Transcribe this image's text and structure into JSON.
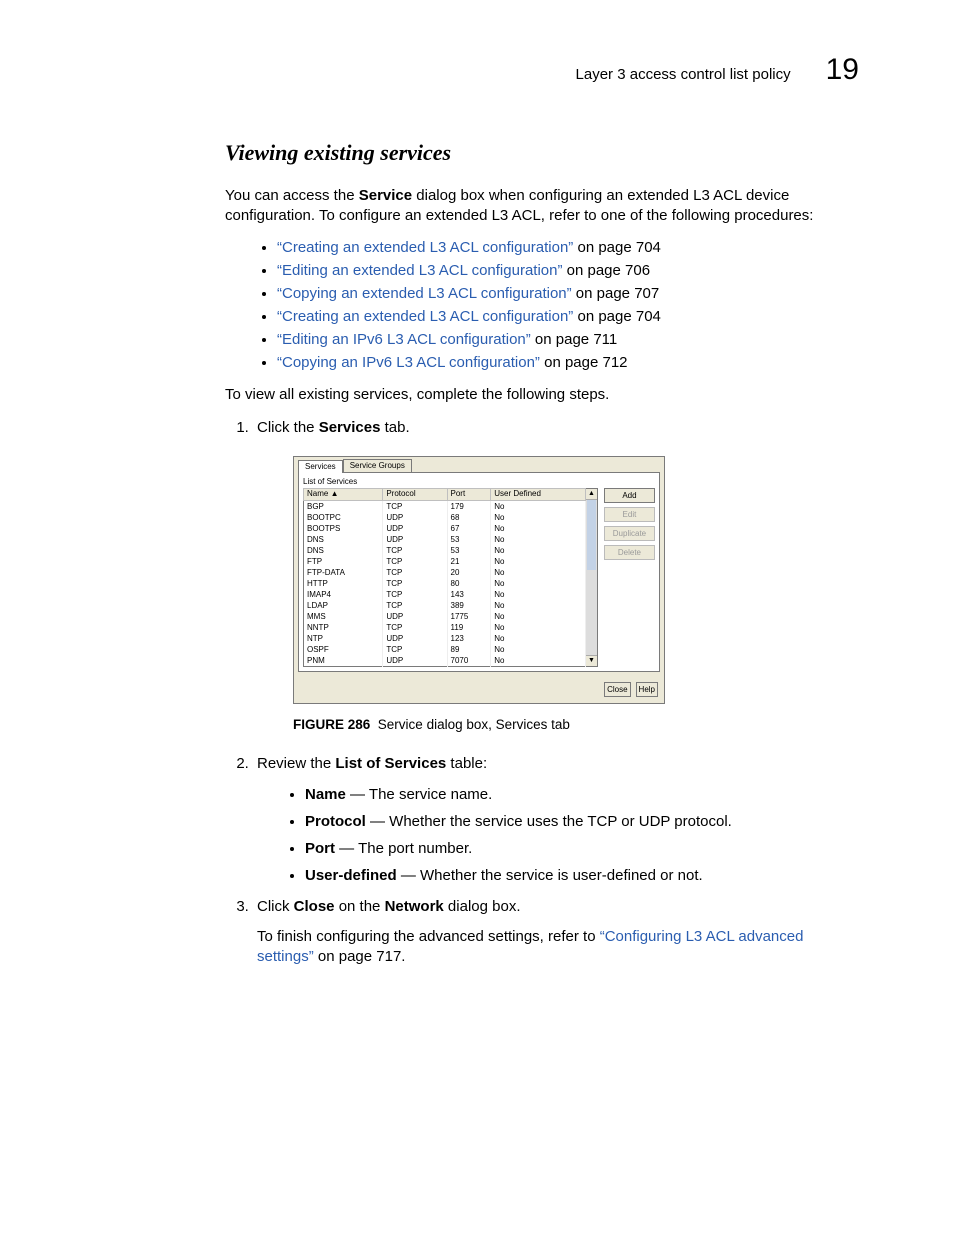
{
  "header": {
    "title": "Layer 3 access control list policy",
    "chapter": "19"
  },
  "section_title": "Viewing existing services",
  "intro": {
    "p1a": "You can access the ",
    "p1b": "Service",
    "p1c": " dialog box when configuring an extended L3 ACL device configuration. To configure an extended L3 ACL, refer to one of the following procedures:"
  },
  "links": [
    {
      "text": "“Creating an extended L3 ACL configuration”",
      "suffix": " on page 704"
    },
    {
      "text": "“Editing an extended L3 ACL configuration”",
      "suffix": " on page 706"
    },
    {
      "text": "“Copying an extended L3 ACL configuration”",
      "suffix": " on page 707"
    },
    {
      "text": "“Creating an extended L3 ACL configuration”",
      "suffix": " on page 704"
    },
    {
      "text": "“Editing an IPv6 L3 ACL configuration”",
      "suffix": " on page 711"
    },
    {
      "text": "“Copying an IPv6 L3 ACL configuration”",
      "suffix": " on page 712"
    }
  ],
  "lead_in": "To view all existing services, complete the following steps.",
  "step1": {
    "pre": "Click the ",
    "bold": "Services",
    "post": " tab."
  },
  "dialog": {
    "tabs": {
      "services": "Services",
      "groups": "Service Groups"
    },
    "list_label": "List of Services",
    "headers": {
      "name": "Name ▲",
      "protocol": "Protocol",
      "port": "Port",
      "userdef": "User Defined"
    },
    "rows": [
      {
        "name": "BGP",
        "protocol": "TCP",
        "port": "179",
        "userdef": "No"
      },
      {
        "name": "BOOTPC",
        "protocol": "UDP",
        "port": "68",
        "userdef": "No"
      },
      {
        "name": "BOOTPS",
        "protocol": "UDP",
        "port": "67",
        "userdef": "No"
      },
      {
        "name": "DNS",
        "protocol": "UDP",
        "port": "53",
        "userdef": "No"
      },
      {
        "name": "DNS",
        "protocol": "TCP",
        "port": "53",
        "userdef": "No"
      },
      {
        "name": "FTP",
        "protocol": "TCP",
        "port": "21",
        "userdef": "No"
      },
      {
        "name": "FTP-DATA",
        "protocol": "TCP",
        "port": "20",
        "userdef": "No"
      },
      {
        "name": "HTTP",
        "protocol": "TCP",
        "port": "80",
        "userdef": "No"
      },
      {
        "name": "IMAP4",
        "protocol": "TCP",
        "port": "143",
        "userdef": "No"
      },
      {
        "name": "LDAP",
        "protocol": "TCP",
        "port": "389",
        "userdef": "No"
      },
      {
        "name": "MMS",
        "protocol": "UDP",
        "port": "1775",
        "userdef": "No"
      },
      {
        "name": "NNTP",
        "protocol": "TCP",
        "port": "119",
        "userdef": "No"
      },
      {
        "name": "NTP",
        "protocol": "UDP",
        "port": "123",
        "userdef": "No"
      },
      {
        "name": "OSPF",
        "protocol": "TCP",
        "port": "89",
        "userdef": "No"
      },
      {
        "name": "PNM",
        "protocol": "UDP",
        "port": "7070",
        "userdef": "No"
      }
    ],
    "buttons": {
      "add": "Add",
      "edit": "Edit",
      "duplicate": "Duplicate",
      "delete": "Delete",
      "close": "Close",
      "help": "Help"
    }
  },
  "figure": {
    "num": "FIGURE 286",
    "caption": "Service dialog box, Services tab"
  },
  "step2": {
    "pre": "Review the ",
    "bold": "List of Services",
    "post": " table:",
    "items": [
      {
        "b": "Name",
        "t": " — The service name."
      },
      {
        "b": "Protocol",
        "t": " — Whether the service uses the TCP or UDP protocol."
      },
      {
        "b": "Port",
        "t": " — The port number."
      },
      {
        "b": "User-defined",
        "t": " — Whether the service is user-defined or not."
      }
    ]
  },
  "step3": {
    "pre": "Click ",
    "b1": "Close",
    "mid": " on the ",
    "b2": "Network",
    "post": " dialog box.",
    "follow_pre": "To finish configuring the advanced settings, refer to ",
    "follow_link": "“Configuring L3 ACL advanced settings”",
    "follow_post": " on page 717."
  }
}
